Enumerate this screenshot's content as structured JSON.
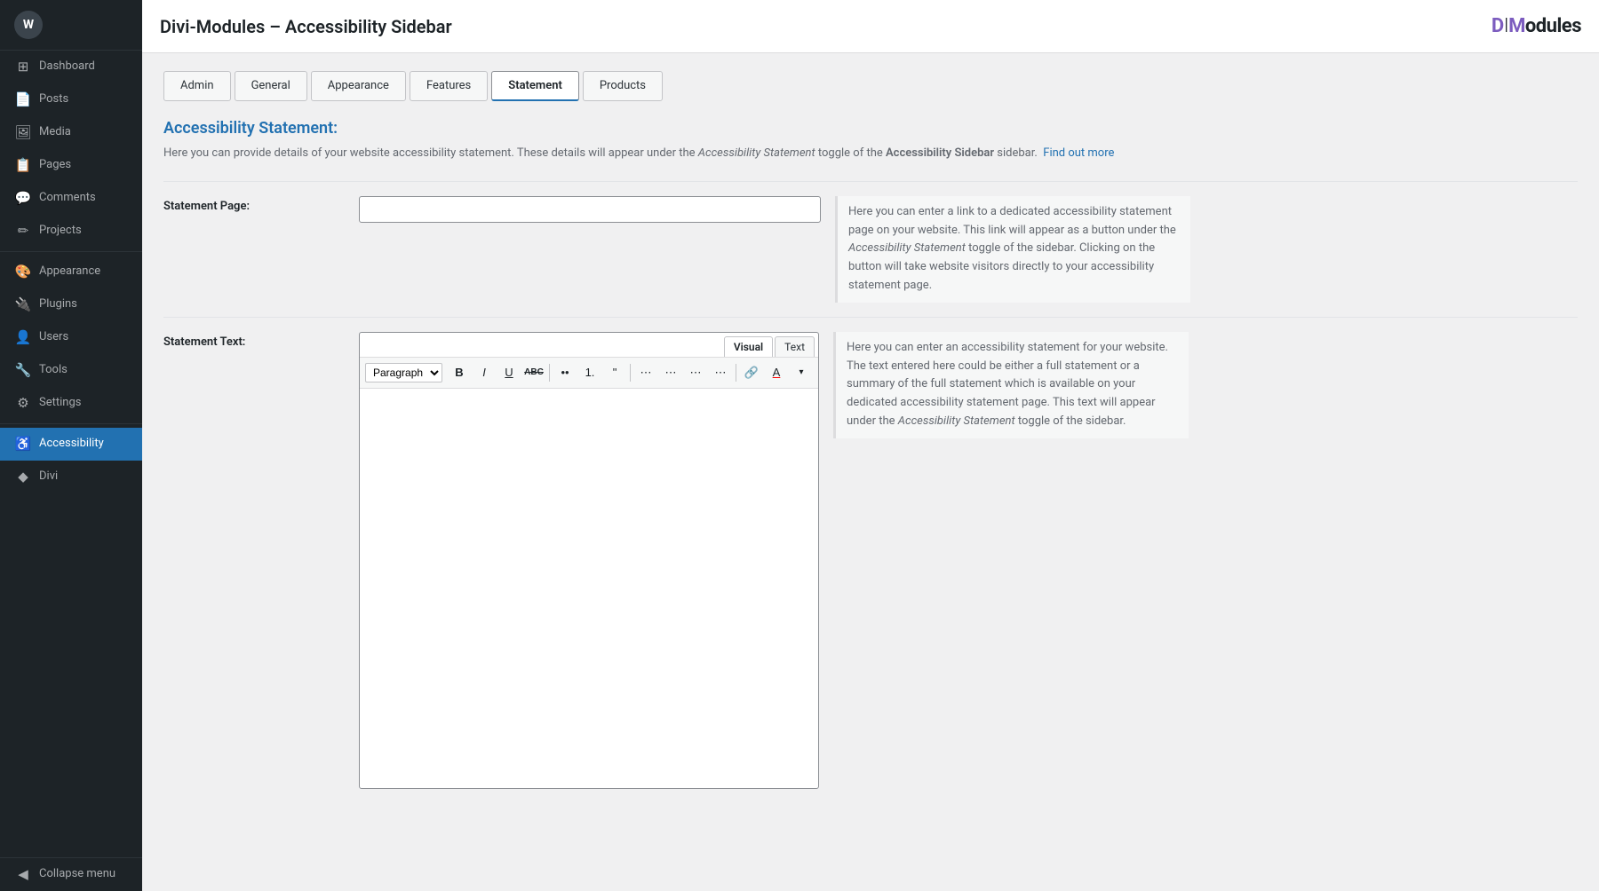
{
  "brand": {
    "name_part1": "DM",
    "name_part2": "odules"
  },
  "page": {
    "title": "Divi-Modules – Accessibility Sidebar"
  },
  "sidebar": {
    "items": [
      {
        "id": "dashboard",
        "label": "Dashboard",
        "icon": "⊞"
      },
      {
        "id": "posts",
        "label": "Posts",
        "icon": "📄"
      },
      {
        "id": "media",
        "label": "Media",
        "icon": "🖼"
      },
      {
        "id": "pages",
        "label": "Pages",
        "icon": "📋"
      },
      {
        "id": "comments",
        "label": "Comments",
        "icon": "💬"
      },
      {
        "id": "projects",
        "label": "Projects",
        "icon": "✏"
      },
      {
        "id": "appearance",
        "label": "Appearance",
        "icon": "🎨"
      },
      {
        "id": "plugins",
        "label": "Plugins",
        "icon": "🔌"
      },
      {
        "id": "users",
        "label": "Users",
        "icon": "👤"
      },
      {
        "id": "tools",
        "label": "Tools",
        "icon": "🔧"
      },
      {
        "id": "settings",
        "label": "Settings",
        "icon": "⚙"
      },
      {
        "id": "accessibility",
        "label": "Accessibility",
        "icon": "♿"
      },
      {
        "id": "divi",
        "label": "Divi",
        "icon": "◆"
      }
    ],
    "collapse_label": "Collapse menu"
  },
  "tabs": [
    {
      "id": "admin",
      "label": "Admin"
    },
    {
      "id": "general",
      "label": "General"
    },
    {
      "id": "appearance",
      "label": "Appearance"
    },
    {
      "id": "features",
      "label": "Features"
    },
    {
      "id": "statement",
      "label": "Statement",
      "active": true
    },
    {
      "id": "products",
      "label": "Products"
    }
  ],
  "section": {
    "heading": "Accessibility Statement:",
    "description_plain": "Here you can provide details of your website accessibility statement. These details will appear under the ",
    "description_italic1": "Accessibility Statement",
    "description_middle": " toggle of the ",
    "description_bold": "Accessibility Sidebar",
    "description_end": " sidebar.",
    "find_out_more": "Find out more"
  },
  "statement_page": {
    "label": "Statement Page:",
    "placeholder": "",
    "hint": "Here you can enter a link to a dedicated accessibility statement page on your website. This link will appear as a button under the ",
    "hint_italic": "Accessibility Statement",
    "hint_middle": " toggle of the sidebar. Clicking on the button will take website visitors directly to your accessibility statement page."
  },
  "statement_text": {
    "label": "Statement Text:",
    "hint": "Here you can enter an accessibility statement for your website. The text entered here could be either a full statement or a summary of the full statement which is available on your dedicated accessibility statement page. This text will appear under the ",
    "hint_italic": "Accessibility Statement",
    "hint_end": " toggle of the sidebar.",
    "tabs": {
      "visual": "Visual",
      "text": "Text"
    },
    "toolbar": {
      "paragraph_select": "Paragraph",
      "bold": "B",
      "italic": "I",
      "underline": "U",
      "strikethrough": "ABC",
      "bullet_list": "≡",
      "numbered_list": "≡",
      "blockquote": "❝",
      "align_left": "≡",
      "align_center": "≡",
      "align_right": "≡",
      "justify": "≡",
      "link": "🔗",
      "text_color": "A"
    }
  }
}
